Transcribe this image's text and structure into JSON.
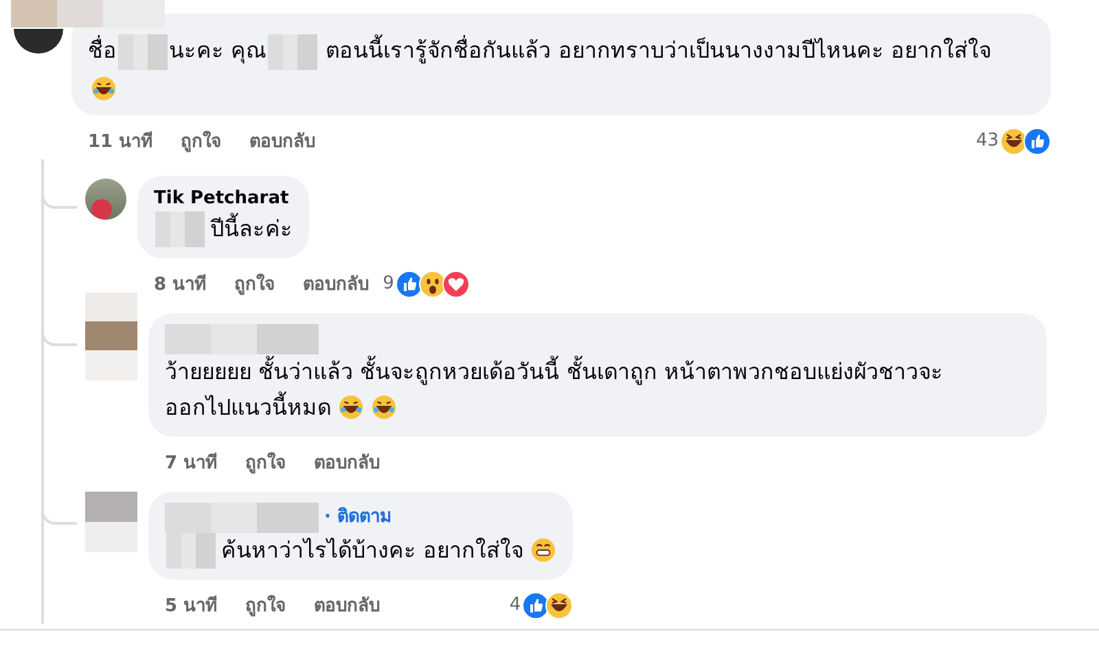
{
  "comments": [
    {
      "author": [
        {
          "kind": "blur"
        }
      ],
      "body": [
        {
          "kind": "text",
          "text": "ชื่อ"
        },
        {
          "kind": "blur"
        },
        {
          "kind": "text",
          "text": "นะคะ คุณ"
        },
        {
          "kind": "blur"
        },
        {
          "kind": "text",
          "text": " ตอนนี้เรารู้จักชื่อกันแล้ว อยากทราบว่าเป็นนางงามปีไหนคะ อยากใส่ใจ"
        },
        {
          "kind": "rofl"
        }
      ],
      "time": "11 นาที",
      "like": "ถูกใจ",
      "reply": "ตอบกลับ",
      "reaction_count": "43",
      "reactions": [
        {
          "kind": "haha"
        },
        {
          "kind": "like"
        }
      ],
      "children": [
        {
          "author": [
            {
              "kind": "text",
              "text": "Tik Petcharat"
            }
          ],
          "avatar": {
            "kind": "photo"
          },
          "body": [
            {
              "kind": "blur"
            },
            {
              "kind": "text",
              "text": "ปีนี้ละค่ะ"
            }
          ],
          "time": "8 นาที",
          "like": "ถูกใจ",
          "reply": "ตอบกลับ",
          "reaction_count": "9",
          "reactions": [
            {
              "kind": "like"
            },
            {
              "kind": "wow"
            },
            {
              "kind": "love"
            }
          ]
        },
        {
          "author": [
            {
              "kind": "blur"
            }
          ],
          "avatar": {
            "kind": "blur"
          },
          "body": [
            {
              "kind": "text",
              "text": "ว้ายยยยย ชั้นว่าแล้ว ชั้นจะถูกหวยเด้อวันนี้ ชั้นเดาถูก หน้าตาพวกชอบแย่งผัวชาวจะ"
            },
            {
              "kind": "text",
              "text": "ออกไปแนวนี้หมด"
            },
            {
              "kind": "rofl"
            },
            {
              "kind": "rofl"
            }
          ],
          "time": "7 นาที",
          "like": "ถูกใจ",
          "reply": "ตอบกลับ"
        },
        {
          "author": [
            {
              "kind": "blur"
            },
            {
              "kind": "follow",
              "text": "· ติดตาม"
            }
          ],
          "avatar": {
            "kind": "blur"
          },
          "body": [
            {
              "kind": "blur"
            },
            {
              "kind": "text",
              "text": "ค้นหาว่าไรได้บ้างคะ อยากใส่ใจ "
            },
            {
              "kind": "grin"
            }
          ],
          "time": "5 นาที",
          "like": "ถูกใจ",
          "reply": "ตอบกลับ",
          "reaction_count": "4",
          "reactions": [
            {
              "kind": "like"
            },
            {
              "kind": "haha"
            }
          ]
        }
      ]
    }
  ]
}
